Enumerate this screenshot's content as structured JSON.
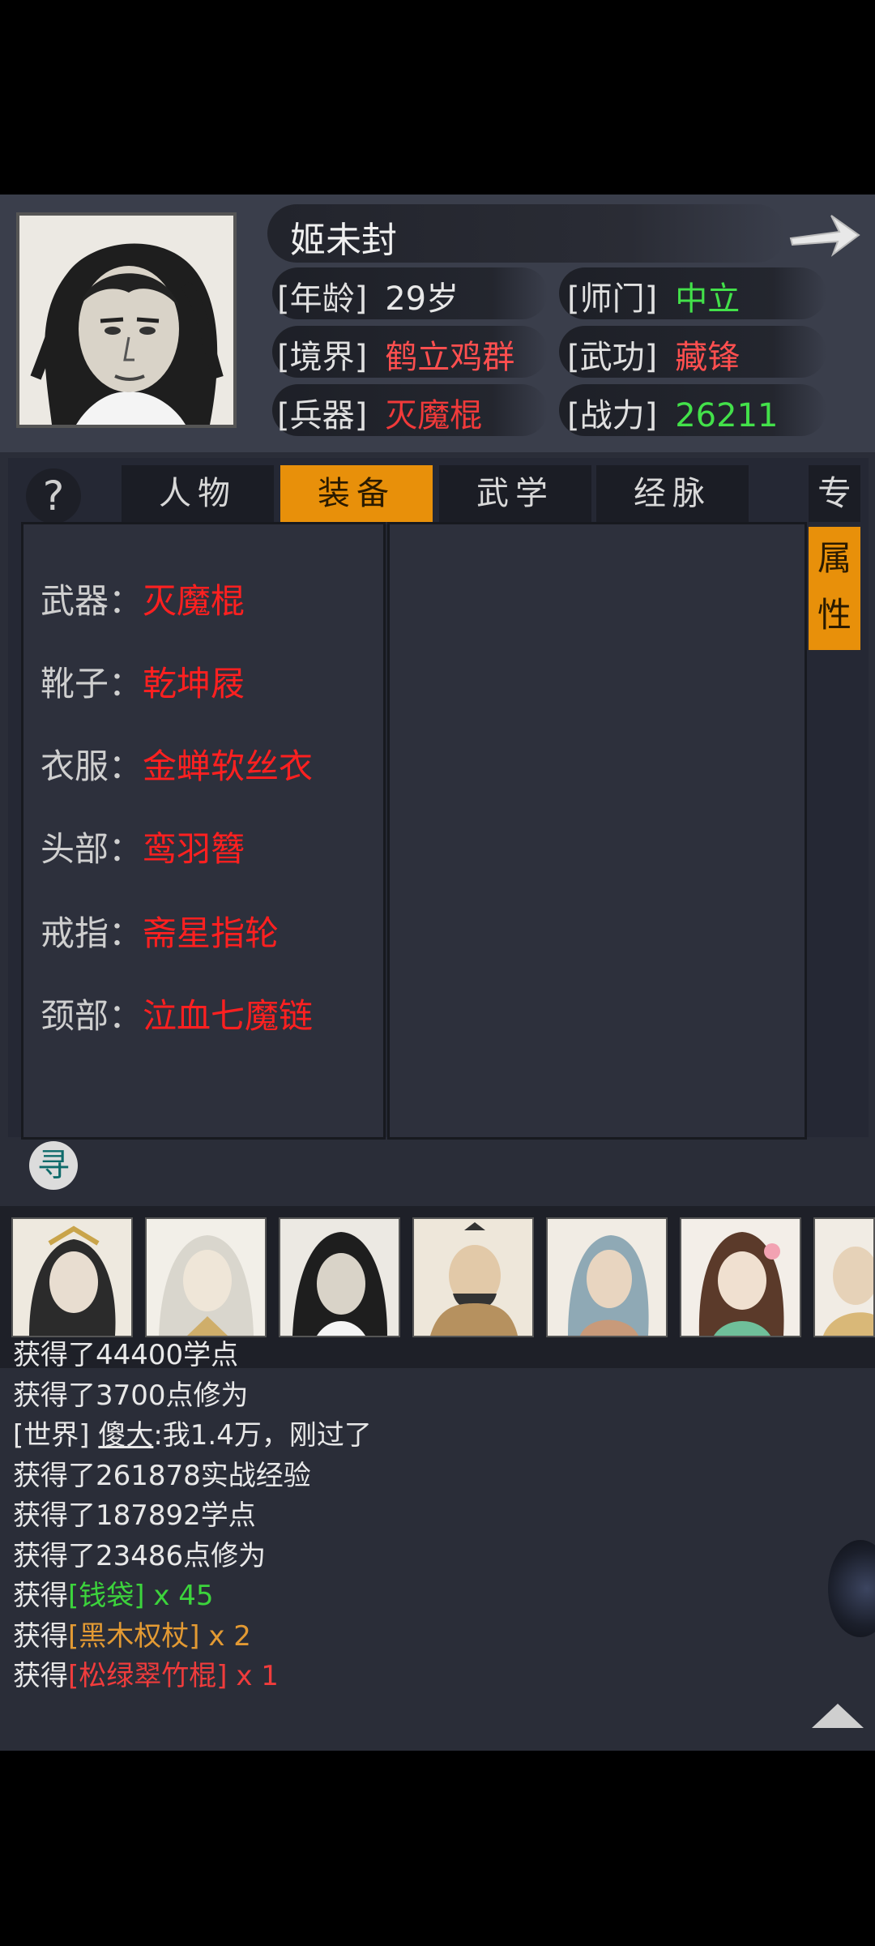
{
  "character": {
    "name": "姬未封",
    "stats": [
      {
        "key": "[年龄]",
        "value": "29岁"
      },
      {
        "key": "[师门]",
        "value": "中立"
      },
      {
        "key": "[境界]",
        "value": "鹤立鸡群"
      },
      {
        "key": "[武功]",
        "value": "藏锋"
      },
      {
        "key": "[兵器]",
        "value": "灭魔棍"
      },
      {
        "key": "[战力]",
        "value": "26211"
      }
    ]
  },
  "tabs": [
    "人物",
    "装备",
    "武学",
    "经脉"
  ],
  "active_tab": "装备",
  "side_tabs": [
    "专",
    "属性"
  ],
  "equipment": [
    {
      "label": "武器：",
      "item": "灭魔棍"
    },
    {
      "label": "靴子：",
      "item": "乾坤屐"
    },
    {
      "label": "衣服：",
      "item": "金蝉软丝衣"
    },
    {
      "label": "头部：",
      "item": "鸾羽簪"
    },
    {
      "label": "戒指：",
      "item": "斋星指轮"
    },
    {
      "label": "颈部：",
      "item": "泣血七魔链"
    }
  ],
  "seek_button": "寻",
  "help_button": "?",
  "log": [
    {
      "text": "获得了44400学点"
    },
    {
      "text": "获得了3700点修为"
    },
    {
      "channel": "[世界]",
      "user": "傻大",
      "msg": ":我1.4万，刚过了"
    },
    {
      "text": "获得了261878实战经验"
    },
    {
      "text": "获得了187892学点"
    },
    {
      "text": "获得了23486点修为"
    },
    {
      "prefix": "获得",
      "item": "[钱袋]",
      "qty": " x 45",
      "color": "green"
    },
    {
      "prefix": "获得",
      "item": "[黑木权杖]",
      "qty": " x 2",
      "color": "orange"
    },
    {
      "prefix": "获得",
      "item": "[松绿翠竹棍]",
      "qty": " x 1",
      "color": "red"
    }
  ],
  "colors": {
    "accent": "#e8900a",
    "equip_red": "#ff2020",
    "neutral_green": "#43e14a"
  }
}
